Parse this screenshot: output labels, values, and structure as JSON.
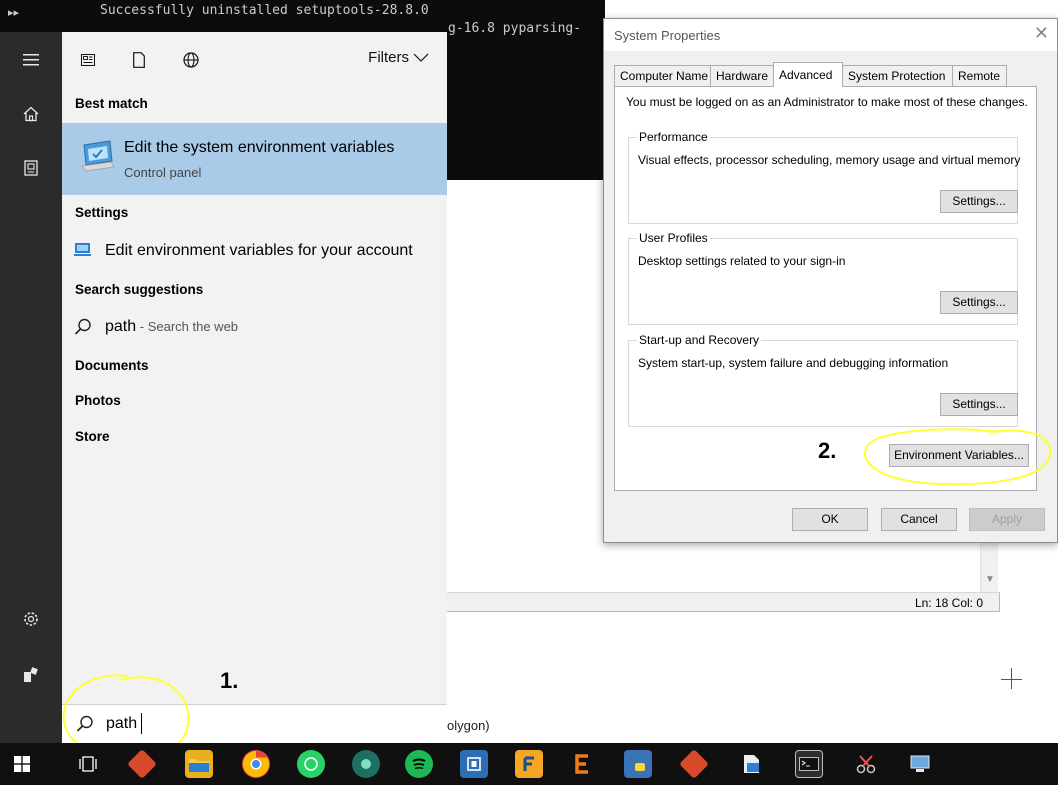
{
  "console": {
    "line1": "Successfully uninstalled setuptools-28.8.0",
    "line2": "g-16.8 pyparsing-"
  },
  "notepad": {
    "status": "Ln: 18  Col: 0",
    "bg_text": "olygon)"
  },
  "start_menu": {
    "filters_label": "Filters",
    "sections": {
      "best_match": "Best match",
      "settings": "Settings",
      "search_suggestions": "Search suggestions",
      "documents": "Documents",
      "photos": "Photos",
      "store": "Store"
    },
    "best_match_item": {
      "title": "Edit the system environment variables",
      "subtitle": "Control panel",
      "icon": "system-settings-icon"
    },
    "settings_item": {
      "label": "Edit environment variables for your account",
      "icon": "monitor-settings-icon"
    },
    "suggestion": {
      "query": "path",
      "hint": " - Search the web",
      "icon": "search-icon"
    },
    "search": {
      "value": "path"
    },
    "rail_icons": [
      "hamburger-menu-icon",
      "home-icon",
      "device-icon",
      "gear-icon",
      "user-icon"
    ]
  },
  "annotations": {
    "step1": "1.",
    "step2": "2.",
    "highlight_color": "#ffff33"
  },
  "dialog": {
    "title": "System Properties",
    "tabs": [
      "Computer Name",
      "Hardware",
      "Advanced",
      "System Protection",
      "Remote"
    ],
    "active_tab": "Advanced",
    "admin_note": "You must be logged on as an Administrator to make most of these changes.",
    "groups": {
      "performance": {
        "legend": "Performance",
        "description": "Visual effects, processor scheduling, memory usage and virtual memory",
        "button": "Settings..."
      },
      "user_profiles": {
        "legend": "User Profiles",
        "description": "Desktop settings related to your sign-in",
        "button": "Settings..."
      },
      "startup": {
        "legend": "Start-up and Recovery",
        "description": "System start-up, system failure and debugging information",
        "button": "Settings..."
      }
    },
    "env_button": "Environment Variables...",
    "ok": "OK",
    "cancel": "Cancel",
    "apply": "Apply"
  },
  "taskbar": {
    "items": [
      {
        "name": "start-button",
        "icon": "windows-logo-icon"
      },
      {
        "name": "task-view-button",
        "icon": "task-view-icon"
      },
      {
        "name": "git-app",
        "icon": "git-icon"
      },
      {
        "name": "file-explorer-app",
        "icon": "folder-icon"
      },
      {
        "name": "chrome-app",
        "icon": "chrome-icon"
      },
      {
        "name": "whatsapp-app",
        "icon": "whatsapp-icon"
      },
      {
        "name": "app-green",
        "icon": "app-icon"
      },
      {
        "name": "spotify-app",
        "icon": "spotify-icon"
      },
      {
        "name": "app-blue-square",
        "icon": "app-icon"
      },
      {
        "name": "app-f",
        "icon": "app-icon"
      },
      {
        "name": "app-e",
        "icon": "app-icon"
      },
      {
        "name": "python-app",
        "icon": "python-icon"
      },
      {
        "name": "git-gui-app",
        "icon": "git-icon"
      },
      {
        "name": "installer-app",
        "icon": "installer-icon"
      },
      {
        "name": "terminal-app",
        "icon": "terminal-icon"
      },
      {
        "name": "snipping-tool-app",
        "icon": "scissors-icon"
      },
      {
        "name": "app-last",
        "icon": "app-icon"
      }
    ]
  }
}
